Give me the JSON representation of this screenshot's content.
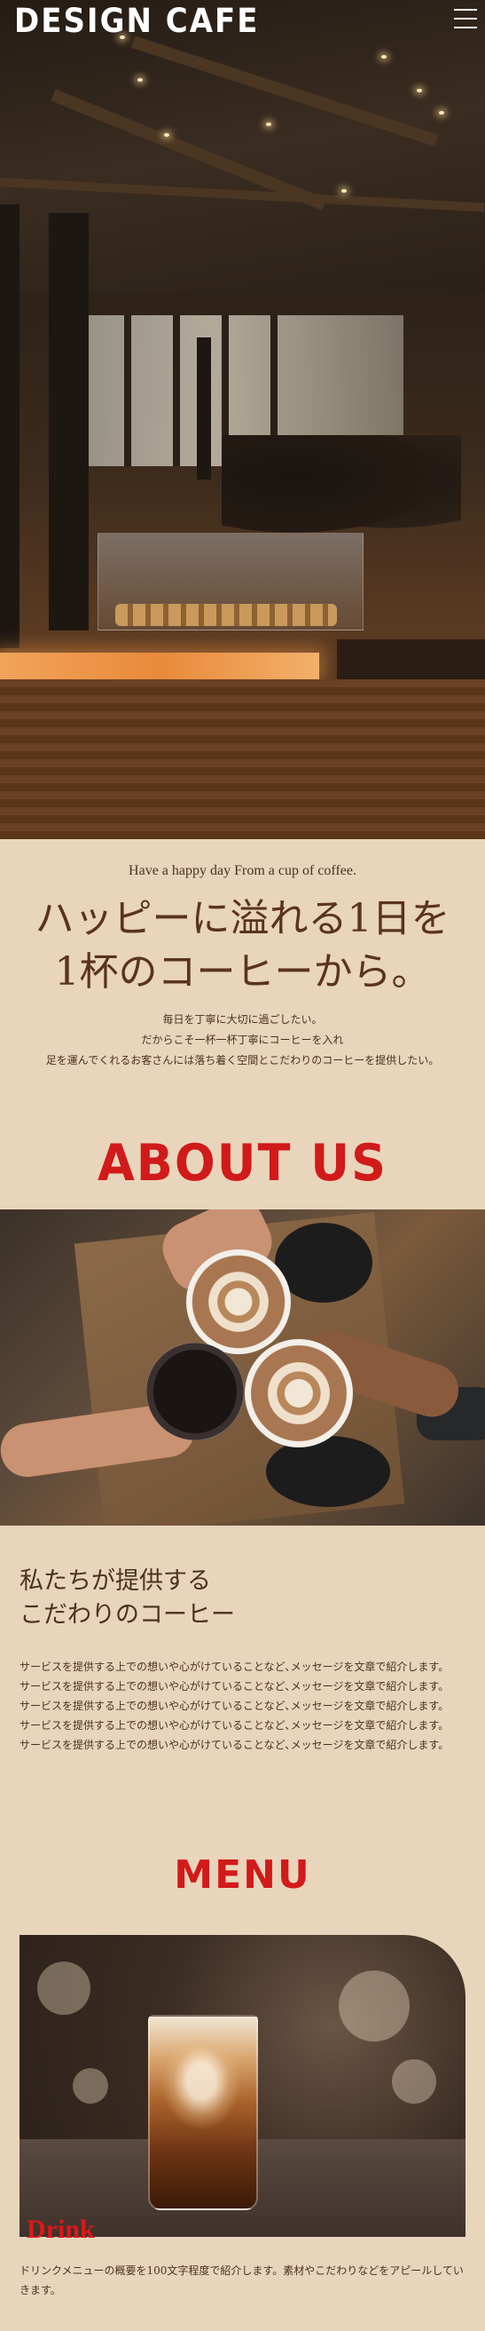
{
  "header": {
    "logo": "DESIGN CAFE",
    "menu_icon": "hamburger-menu-icon"
  },
  "hero": {
    "image_alt": "cafe interior"
  },
  "intro": {
    "tagline_en": "Have a happy day From a cup of coffee.",
    "headline_line1": "ハッピーに溢れる1日を",
    "headline_line2": "1杯のコーヒーから。",
    "body": [
      "毎日を丁寧に大切に過ごしたい。",
      "だからこそ一杯一杯丁寧にコーヒーを入れ",
      "足を運んでくれるお客さんには落ち着く空間とこだわりのコーヒーを提供したい。"
    ]
  },
  "about": {
    "title": "ABOUT US",
    "heading_line1": "私たちが提供する",
    "heading_line2": "こだわりのコーヒー",
    "body": [
      "サービスを提供する上での想いや心がけていることなど､メッセージを文章で紹介します。",
      "サービスを提供する上での想いや心がけていることなど､メッセージを文章で紹介します。",
      "サービスを提供する上での想いや心がけていることなど､メッセージを文章で紹介します。",
      "サービスを提供する上での想いや心がけていることなど､メッセージを文章で紹介します。",
      "サービスを提供する上での想いや心がけていることなど､メッセージを文章で紹介します。"
    ]
  },
  "menu": {
    "title": "MENU",
    "item_label": "Drink",
    "item_body": "ドリンクメニューの概要を100文字程度で紹介します。素材やこだわりなどをアピールしていきます。"
  },
  "colors": {
    "background": "#e8d5bb",
    "accent_red": "#d11a1a",
    "text_brown": "#4a3220"
  }
}
